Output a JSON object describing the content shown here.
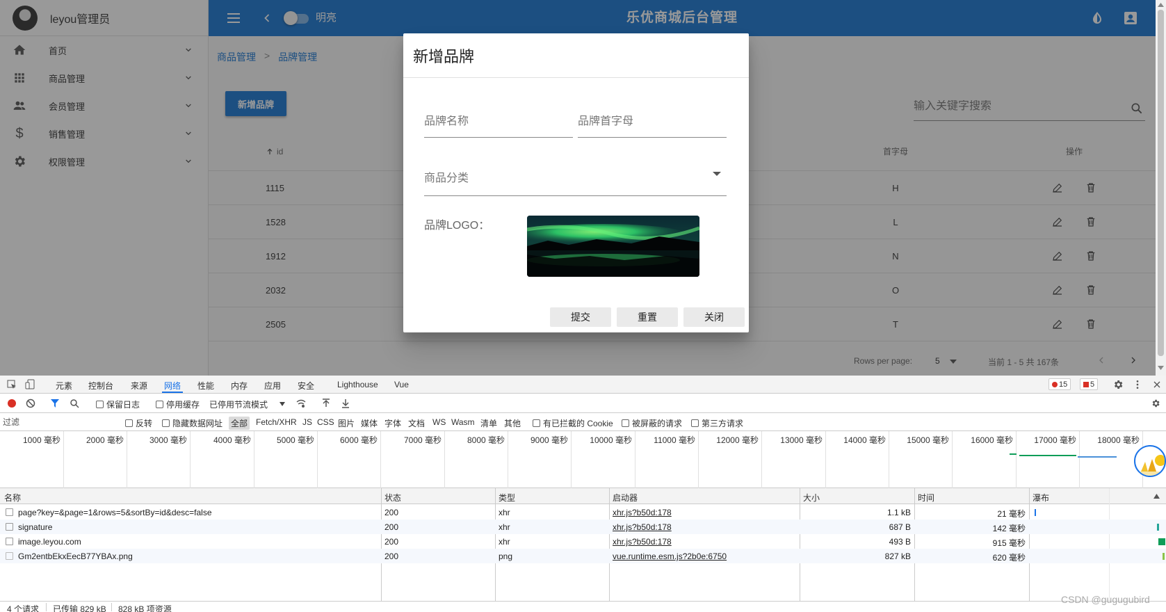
{
  "sidebar": {
    "user_name": "leyou管理员",
    "items": [
      {
        "label": "首页",
        "icon": "home-icon"
      },
      {
        "label": "商品管理",
        "icon": "apps-icon"
      },
      {
        "label": "会员管理",
        "icon": "people-icon"
      },
      {
        "label": "销售管理",
        "icon": "dollar-icon"
      },
      {
        "label": "权限管理",
        "icon": "gear-icon"
      }
    ]
  },
  "topbar": {
    "mode_label": "明亮",
    "title": "乐优商城后台管理"
  },
  "breadcrumb": {
    "items": [
      "商品管理",
      "品牌管理"
    ],
    "separator": ">"
  },
  "toolbar": {
    "add_button": "新增品牌",
    "search_placeholder": "输入关键字搜索"
  },
  "table": {
    "headers": {
      "id": "id",
      "letter": "首字母",
      "ops": "操作"
    },
    "rows": [
      {
        "id": "1115",
        "letter": "H"
      },
      {
        "id": "1528",
        "letter": "L"
      },
      {
        "id": "1912",
        "letter": "N"
      },
      {
        "id": "2032",
        "letter": "O"
      },
      {
        "id": "2505",
        "letter": "T"
      }
    ]
  },
  "pagination": {
    "rows_per_page_label": "Rows per page:",
    "rows_per_page": "5",
    "range_text": "当前 1 - 5 共 167条"
  },
  "dialog": {
    "title": "新增品牌",
    "name_placeholder": "品牌名称",
    "letter_placeholder": "品牌首字母",
    "category_label": "商品分类",
    "logo_label": "品牌LOGO：",
    "submit": "提交",
    "reset": "重置",
    "close": "关闭"
  },
  "devtools": {
    "tabs": [
      "元素",
      "控制台",
      "来源",
      "网络",
      "性能",
      "内存",
      "应用",
      "安全",
      "Lighthouse",
      "Vue"
    ],
    "active_tab": "网络",
    "error_count": "15",
    "warning_count": "5",
    "toolbar": {
      "preserve_log": "保留日志",
      "disable_cache": "停用缓存",
      "throttle": "已停用节流模式"
    },
    "filter": {
      "placeholder": "过滤",
      "invert": "反转",
      "hide_data_urls": "隐藏数据网址",
      "types": [
        "全部",
        "Fetch/XHR",
        "JS",
        "CSS",
        "图片",
        "媒体",
        "字体",
        "文档",
        "WS",
        "Wasm",
        "清单",
        "其他"
      ],
      "blocked_cookies": "有已拦截的 Cookie",
      "blocked_requests": "被屏蔽的请求",
      "third_party": "第三方请求"
    },
    "timeline_ticks": [
      "1000 毫秒",
      "2000 毫秒",
      "3000 毫秒",
      "4000 毫秒",
      "5000 毫秒",
      "6000 毫秒",
      "7000 毫秒",
      "8000 毫秒",
      "9000 毫秒",
      "10000 毫秒",
      "11000 毫秒",
      "12000 毫秒",
      "13000 毫秒",
      "14000 毫秒",
      "15000 毫秒",
      "16000 毫秒",
      "17000 毫秒",
      "18000 毫秒"
    ],
    "columns": {
      "name": "名称",
      "status": "状态",
      "type": "类型",
      "initiator": "启动器",
      "size": "大小",
      "time": "时间",
      "waterfall": "瀑布"
    },
    "requests": [
      {
        "name": "page?key=&page=1&rows=5&sortBy=id&desc=false",
        "status": "200",
        "type": "xhr",
        "initiator": "xhr.js?b50d:178",
        "size": "1.1 kB",
        "time": "21 毫秒"
      },
      {
        "name": "signature",
        "status": "200",
        "type": "xhr",
        "initiator": "xhr.js?b50d:178",
        "size": "687 B",
        "time": "142 毫秒"
      },
      {
        "name": "image.leyou.com",
        "status": "200",
        "type": "xhr",
        "initiator": "xhr.js?b50d:178",
        "size": "493 B",
        "time": "915 毫秒"
      },
      {
        "name": "Gm2entbEkxEecB77YBAx.png",
        "status": "200",
        "type": "png",
        "initiator": "vue.runtime.esm.js?2b0e:6750",
        "size": "827 kB",
        "time": "620 毫秒"
      }
    ],
    "status_bar": {
      "requests": "4 个请求",
      "transferred": "已传输 829 kB",
      "resources": "828 kB 项资源"
    }
  },
  "watermark": "CSDN @gugugubird",
  "colors": {
    "primary": "#1976d2",
    "devtools_accent": "#1a73e8",
    "error": "#d93025"
  }
}
